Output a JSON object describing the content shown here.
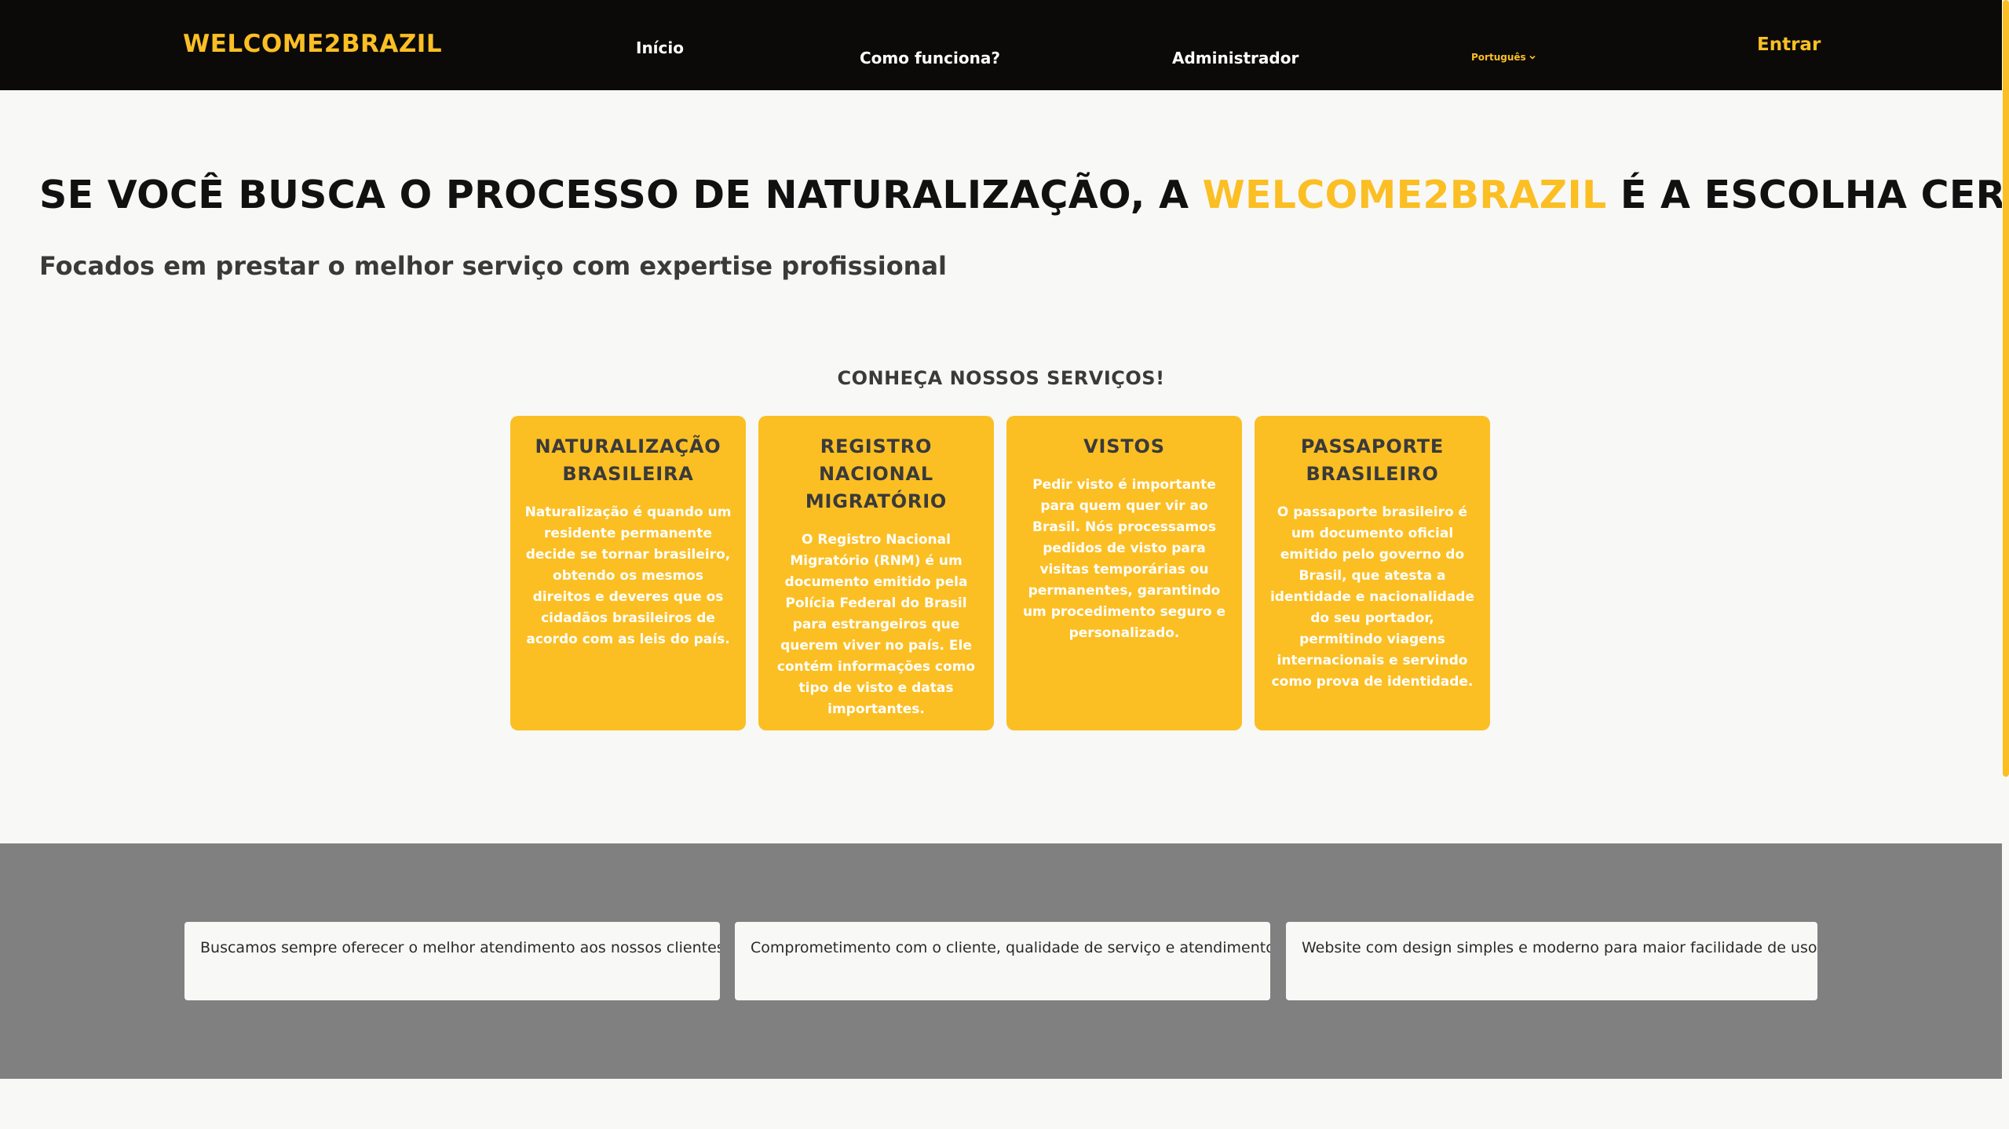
{
  "nav": {
    "logo": "WELCOME2BRAZIL",
    "links": {
      "inicio": "Início",
      "como_funciona": "Como funciona?",
      "administrador": "Administrador"
    },
    "language": "Português",
    "login": "Entrar"
  },
  "hero": {
    "title_before": "SE VOCÊ BUSCA O PROCESSO DE NATURALIZAÇÃO, A ",
    "title_brand": "WELCOME2BRAZIL",
    "title_after": " É A ESCOLHA CERTA!",
    "subtitle": "Focados em prestar o melhor serviço com expertise profissional"
  },
  "services": {
    "heading": "CONHEÇA NOSSOS SERVIÇOS!",
    "cards": [
      {
        "title": "NATURALIZAÇÃO BRASILEIRA",
        "text": "Naturalização é quando um residente permanente decide se tornar brasileiro, obtendo os mesmos direitos e deveres que os cidadãos brasileiros de acordo com as leis do país."
      },
      {
        "title": "REGISTRO NACIONAL MIGRATÓRIO",
        "text": "O Registro Nacional Migratório (RNM) é um documento emitido pela Polícia Federal do Brasil para estrangeiros que querem viver no país. Ele contém informações como tipo de visto e datas importantes."
      },
      {
        "title": "VISTOS",
        "text": "Pedir visto é importante para quem quer vir ao Brasil. Nós processamos pedidos de visto para visitas temporárias ou permanentes, garantindo um procedimento seguro e personalizado."
      },
      {
        "title": "PASSAPORTE BRASILEIRO",
        "text": "O passaporte brasileiro é um documento oficial emitido pelo governo do Brasil, que atesta a identidade e nacionalidade do seu portador, permitindo viagens internacionais e servindo como prova de identidade."
      }
    ]
  },
  "features": [
    "Buscamos sempre oferecer o melhor atendimento aos nossos clientes.",
    "Comprometimento com o cliente, qualidade de serviço e atendimento.",
    "Website com design simples e moderno para maior facilidade de uso!"
  ],
  "colors": {
    "brand_yellow": "#fbbf24",
    "navbar_bg": "#0b0a09",
    "page_bg": "#f8f8f6",
    "band_gray": "#808080"
  },
  "icons": {
    "language_dropdown": "chevron-down-icon"
  }
}
